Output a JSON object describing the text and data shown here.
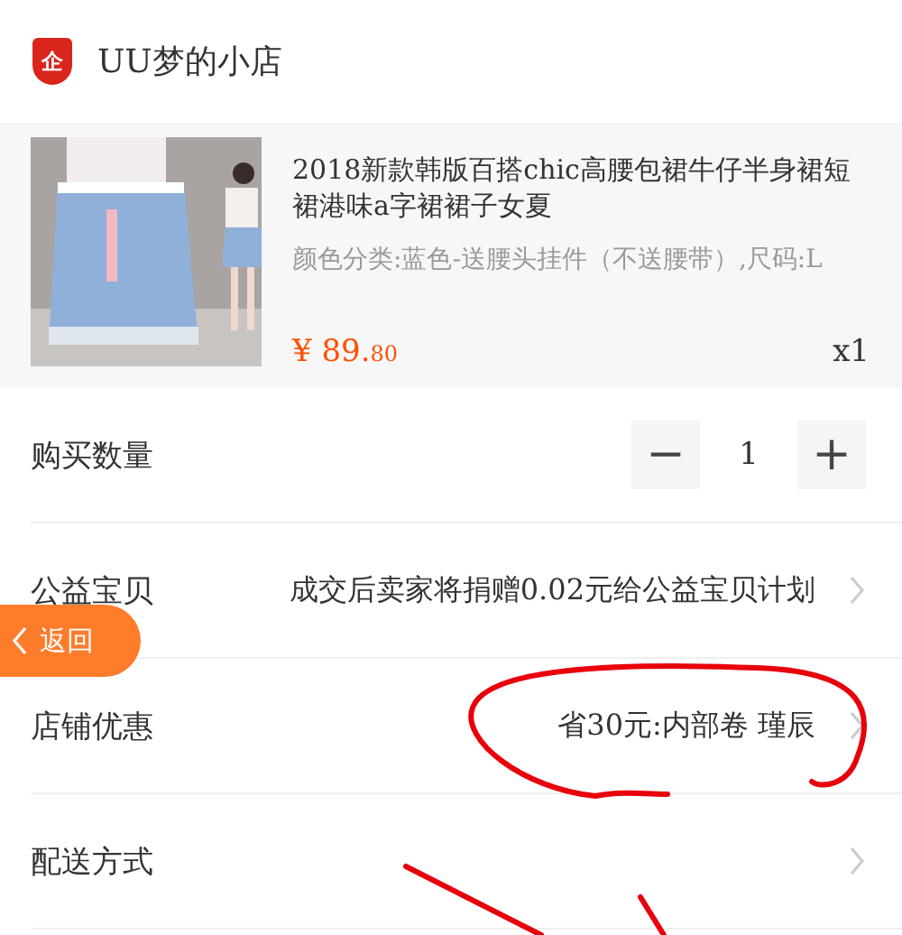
{
  "shop": {
    "name": "UU梦的小店",
    "badge": "企"
  },
  "product": {
    "kind": "picture",
    "title": "2018新款韩版百搭chic高腰包裙牛仔半身裙短裙港味a字裙裙子女夏",
    "spec": "颜色分类:蓝色-送腰头挂件（不送腰带）,尺码:L",
    "currency": "¥",
    "price_main": "89.",
    "price_cents": "80",
    "count": "x1"
  },
  "rows": [
    {
      "kind": "stepper",
      "label": "购买数量",
      "minus": "−",
      "value": "1",
      "plus": "+"
    },
    {
      "kind": "link",
      "label": "公益宝贝",
      "value": "成交后卖家将捐赠0.02元给公益宝贝计划"
    },
    {
      "kind": "link",
      "label": "店铺优惠",
      "value": "省30元:内部卷 瑾辰"
    },
    {
      "kind": "link",
      "label": "配送方式"
    }
  ],
  "back_button": {
    "label": "返回"
  }
}
